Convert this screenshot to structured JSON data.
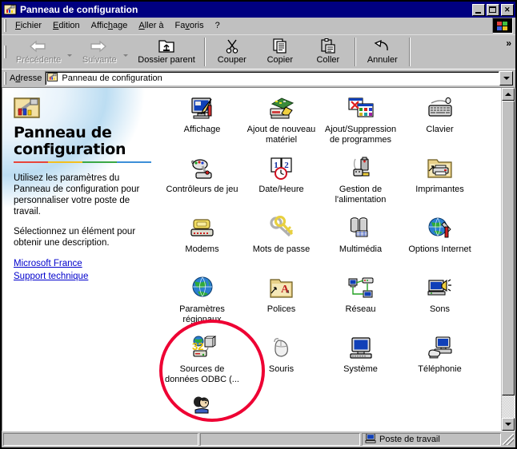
{
  "window": {
    "title": "Panneau de configuration",
    "title_icon": "control-panel-folder-icon",
    "minimize_label": "",
    "maximize_label": "",
    "close_label": ""
  },
  "menu": {
    "items": [
      {
        "label": "Fichier",
        "accel": "F"
      },
      {
        "label": "Edition",
        "accel": "E"
      },
      {
        "label": "Affichage",
        "accel": "h"
      },
      {
        "label": "Aller à",
        "accel": "A"
      },
      {
        "label": "Favoris",
        "accel": "v"
      },
      {
        "label": "?",
        "accel": ""
      }
    ]
  },
  "toolbar": {
    "buttons": [
      {
        "label": "Précédente",
        "icon": "back-arrow-icon",
        "disabled": true,
        "dropdown": true
      },
      {
        "label": "Suivante",
        "icon": "forward-arrow-icon",
        "disabled": true,
        "dropdown": true
      },
      {
        "label": "Dossier parent",
        "icon": "up-folder-icon",
        "disabled": false,
        "dropdown": false
      },
      {
        "label": "Couper",
        "icon": "scissors-icon",
        "disabled": false,
        "dropdown": false
      },
      {
        "label": "Copier",
        "icon": "copy-pages-icon",
        "disabled": false,
        "dropdown": false
      },
      {
        "label": "Coller",
        "icon": "clipboard-paste-icon",
        "disabled": false,
        "dropdown": false
      },
      {
        "label": "Annuler",
        "icon": "undo-arrow-icon",
        "disabled": false,
        "dropdown": false
      }
    ],
    "overflow_chevron": "»"
  },
  "address": {
    "label": "Adresse",
    "value": "Panneau de configuration",
    "icon": "control-panel-folder-icon",
    "dropdown_icon": "chevron-down-icon"
  },
  "info_panel": {
    "icon": "control-panel-tools-icon",
    "title": "Panneau de configuration",
    "rule_colors": [
      "#e8443a",
      "#f3bf1f",
      "#3aa845",
      "#3d8fd8"
    ],
    "paragraphs": [
      "Utilisez les paramètres du Panneau de configuration pour personnaliser votre poste de travail.",
      "Sélectionnez un élément pour obtenir une description."
    ],
    "links": [
      {
        "label": "Microsoft France"
      },
      {
        "label": "Support technique"
      }
    ]
  },
  "items": [
    {
      "label": "Affichage",
      "icon": "display-monitor-icon"
    },
    {
      "label": "Ajout de nouveau matériel",
      "icon": "add-new-hardware-icon"
    },
    {
      "label": "Ajout/Suppression de programmes",
      "icon": "add-remove-programs-icon"
    },
    {
      "label": "Clavier",
      "icon": "keyboard-icon"
    },
    {
      "label": "Contrôleurs de jeu",
      "icon": "gamepad-icon"
    },
    {
      "label": "Date/Heure",
      "icon": "date-time-clock-icon"
    },
    {
      "label": "Gestion de l'alimentation",
      "icon": "power-management-icon"
    },
    {
      "label": "Imprimantes",
      "icon": "printers-folder-icon"
    },
    {
      "label": "Modems",
      "icon": "modem-phone-icon"
    },
    {
      "label": "Mots de passe",
      "icon": "passwords-key-icon"
    },
    {
      "label": "Multimédia",
      "icon": "multimedia-icon"
    },
    {
      "label": "Options Internet",
      "icon": "internet-options-globe-icon"
    },
    {
      "label": "Paramètres régionaux",
      "icon": "regional-settings-globe-icon"
    },
    {
      "label": "Polices",
      "icon": "fonts-folder-icon"
    },
    {
      "label": "Réseau",
      "icon": "network-icon"
    },
    {
      "label": "Sons",
      "icon": "sounds-speaker-icon"
    },
    {
      "label": "Sources de données ODBC (...",
      "icon": "odbc-data-sources-icon"
    },
    {
      "label": "Souris",
      "icon": "mouse-icon"
    },
    {
      "label": "Système",
      "icon": "system-computer-icon"
    },
    {
      "label": "Téléphonie",
      "icon": "telephony-icon"
    }
  ],
  "annotation": {
    "shape": "ellipse",
    "color": "#ee0033",
    "targets": "Sources de données ODBC (..."
  },
  "scrollbar": {
    "up_icon": "scroll-up-arrow-icon",
    "down_icon": "scroll-down-arrow-icon",
    "thumb_position": "top"
  },
  "statusbar": {
    "panel1": "",
    "panel2": "",
    "panel3": "Poste de travail",
    "panel3_icon": "my-computer-icon"
  }
}
